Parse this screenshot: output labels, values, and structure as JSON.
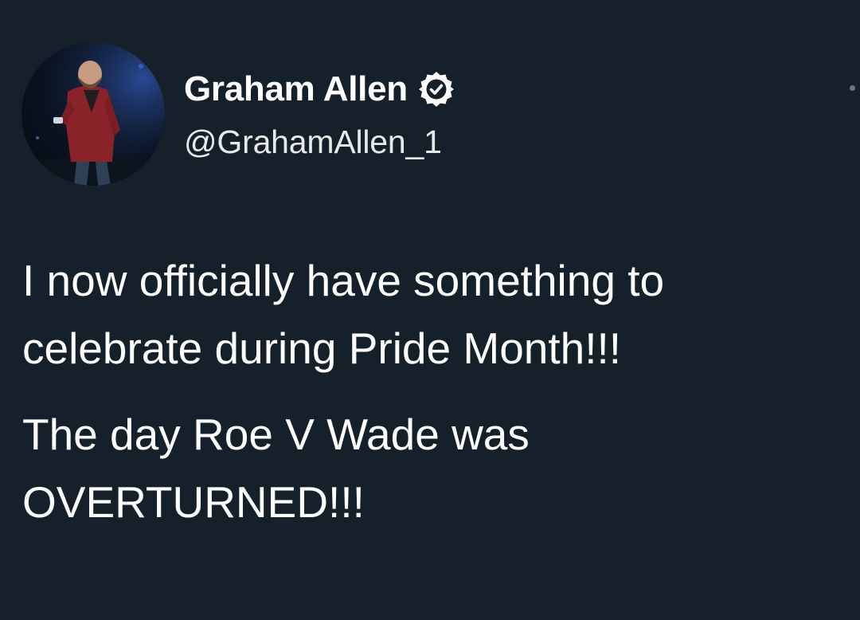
{
  "tweet": {
    "author": {
      "display_name": "Graham Allen",
      "handle": "@GrahamAllen_1",
      "avatar_icon": "profile-photo",
      "verified_icon": "verified-badge-icon"
    },
    "body": {
      "paragraphs": [
        {
          "lines": [
            "I now officially have something to",
            "celebrate during Pride Month!!!"
          ]
        },
        {
          "lines": [
            "The day Roe V Wade was",
            "OVERTURNED!!!"
          ]
        }
      ]
    }
  },
  "theme": {
    "background": "#15202b",
    "text_primary": "#ffffff",
    "text_secondary": "#e7e9ea"
  }
}
